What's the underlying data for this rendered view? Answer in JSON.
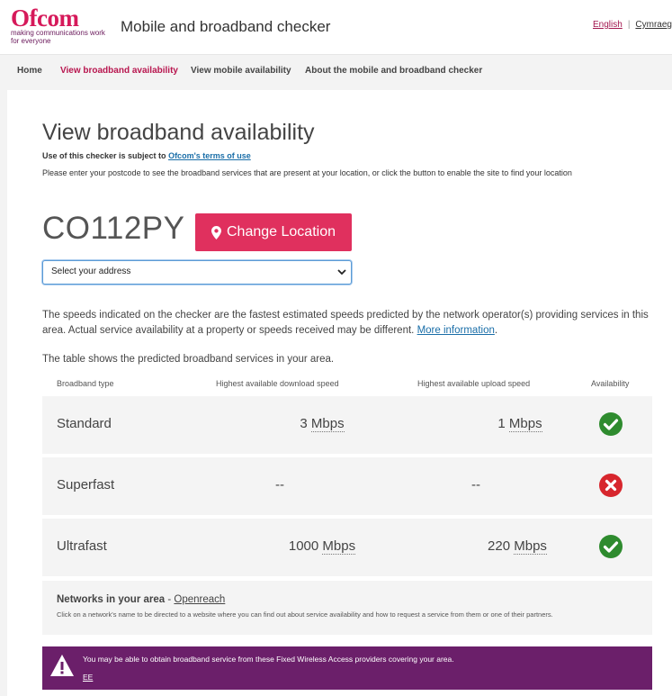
{
  "header": {
    "logo_word": "Ofcom",
    "logo_tag_1": "making communications work",
    "logo_tag_2": "for everyone",
    "site_title": "Mobile and broadband checker",
    "lang_english": "English",
    "lang_welsh": "Cymraeg"
  },
  "nav": {
    "items": [
      {
        "label": "Home"
      },
      {
        "label": "View broadband availability"
      },
      {
        "label": "View mobile availability"
      },
      {
        "label": "About the mobile and broadband checker"
      }
    ],
    "active_index": 1
  },
  "main": {
    "title": "View broadband availability",
    "terms_text": "Use of this checker is subject to",
    "terms_link": "Ofcom's terms of use",
    "instructions": "Please enter your postcode to see the broadband services that are present at your location, or click the button to enable the site to find your location",
    "postcode": "CO112PY",
    "change_location_label": "Change Location",
    "address_select_value": "Select your address",
    "disclaimer": "The speeds indicated on the checker are the fastest estimated speeds predicted by the network operator(s) providing services in this area. Actual service availability at a property or speeds received may be different.",
    "more_info_link": "More information",
    "table_intro": "The table shows the predicted broadband services in your area."
  },
  "table": {
    "headers": [
      "Broadband type",
      "Highest available download speed",
      "Highest available upload speed",
      "Availability"
    ],
    "rows": [
      {
        "type": "Standard",
        "download_value": "3",
        "download_unit": "Mbps",
        "upload_value": "1",
        "upload_unit": "Mbps",
        "available": true
      },
      {
        "type": "Superfast",
        "download_value": "--",
        "download_unit": "",
        "upload_value": "--",
        "upload_unit": "",
        "available": false
      },
      {
        "type": "Ultrafast",
        "download_value": "1000",
        "download_unit": "Mbps",
        "upload_value": "220",
        "upload_unit": "Mbps",
        "available": true
      }
    ]
  },
  "networks": {
    "title": "Networks in your area",
    "separator": "-",
    "provider": "Openreach",
    "description": "Click on a network's name to be directed to a website where you can find out about service availability and how to request a service from them or one of their partners."
  },
  "fwa": {
    "message": "You may be able to obtain broadband service from these Fixed Wireless Access providers covering your area.",
    "provider": "EE"
  },
  "colors": {
    "brand_pink": "#d6195a",
    "button_pink": "#e0305e",
    "available_green": "#2e8b2e",
    "unavailable_red": "#d7262d",
    "fwa_purple": "#6b1f6a"
  }
}
